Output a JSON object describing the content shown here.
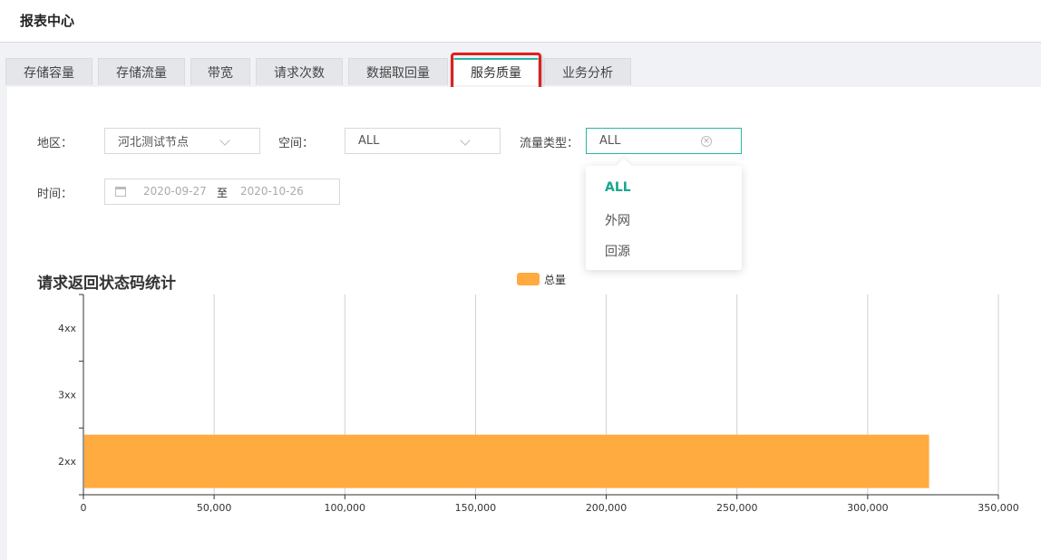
{
  "header": {
    "title": "报表中心"
  },
  "tabs": [
    {
      "label": "存储容量",
      "active": false
    },
    {
      "label": "存储流量",
      "active": false
    },
    {
      "label": "带宽",
      "active": false
    },
    {
      "label": "请求次数",
      "active": false
    },
    {
      "label": "数据取回量",
      "active": false
    },
    {
      "label": "服务质量",
      "active": true
    },
    {
      "label": "业务分析",
      "active": false
    }
  ],
  "filters": {
    "region": {
      "label": "地区：",
      "value": "河北测试节点"
    },
    "space": {
      "label": "空间：",
      "value": "ALL"
    },
    "traffic_type": {
      "label": "流量类型：",
      "value": "ALL",
      "clear_icon": "x-circle-icon"
    },
    "time": {
      "label": "时间：",
      "start": "2020-09-27",
      "separator": "至",
      "end": "2020-10-26",
      "icon": "calendar-icon"
    }
  },
  "dropdown": {
    "options": [
      {
        "label": "ALL",
        "selected": true
      },
      {
        "label": "外网",
        "selected": false
      },
      {
        "label": "回源",
        "selected": false
      }
    ]
  },
  "colors": {
    "accent": "#2bb5a8",
    "selected_option": "#17a78e",
    "bar": "#ffab40",
    "highlight_box": "#e0201c"
  },
  "chart_data": {
    "type": "bar",
    "orientation": "horizontal",
    "title": "请求返回状态码统计",
    "categories": [
      "2xx",
      "3xx",
      "4xx"
    ],
    "series": [
      {
        "name": "总量",
        "values": [
          323500,
          0,
          0
        ]
      }
    ],
    "xlim": [
      0,
      350000
    ],
    "xticks": [
      "0",
      "50,000",
      "100,000",
      "150,000",
      "200,000",
      "250,000",
      "300,000",
      "350,000"
    ],
    "xtick_values": [
      0,
      50000,
      100000,
      150000,
      200000,
      250000,
      300000,
      350000
    ],
    "grid": "vertical",
    "legend_position": "top-center"
  }
}
